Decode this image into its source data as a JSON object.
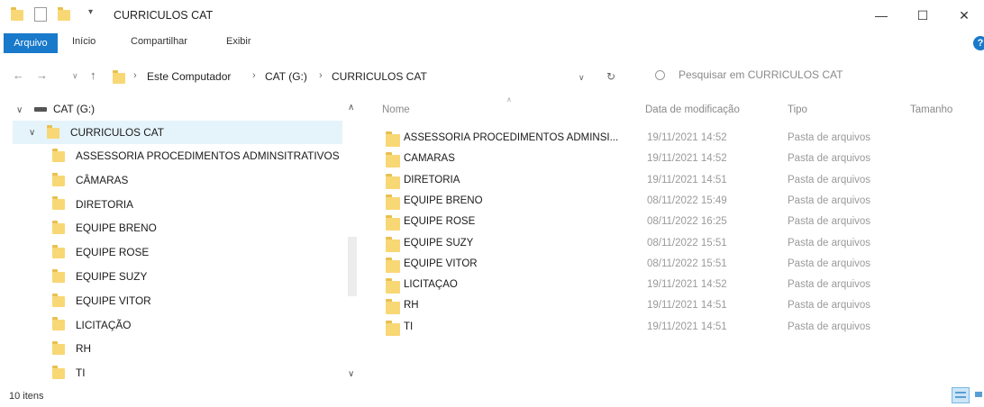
{
  "window": {
    "title": "CURRICULOS CAT",
    "minimize": "—",
    "maximize": "☐",
    "close": "✕"
  },
  "ribbon": {
    "tabs": [
      "Arquivo",
      "Início",
      "Compartilhar",
      "Exibir"
    ],
    "help": "?"
  },
  "address": {
    "back": "←",
    "forward": "→",
    "recent": "∨",
    "up": "↑",
    "crumbs": [
      "Este Computador",
      "CAT (G:)",
      "CURRICULOS CAT"
    ],
    "dropdown": "∨",
    "refresh": "↻",
    "search_placeholder": "Pesquisar em CURRICULOS CAT"
  },
  "navpane": {
    "drive": "CAT (G:)",
    "current": "CURRICULOS CAT",
    "children": [
      "ASSESSORIA PROCEDIMENTOS ADMINSITRATIVOS",
      "CÂMARAS",
      "DIRETORIA",
      "EQUIPE BRENO",
      "EQUIPE ROSE",
      "EQUIPE SUZY",
      "EQUIPE VITOR",
      "LICITAÇÃO",
      "RH",
      "TI"
    ]
  },
  "filelist": {
    "columns": [
      "Nome",
      "Data de modificação",
      "Tipo",
      "Tamanho"
    ],
    "rows": [
      {
        "name": "ASSESSORIA PROCEDIMENTOS ADMINSI...",
        "date": "19/11/2021 14:52",
        "type": "Pasta de arquivos"
      },
      {
        "name": "CÂMARAS",
        "date": "19/11/2021 14:52",
        "type": "Pasta de arquivos"
      },
      {
        "name": "DIRETORIA",
        "date": "19/11/2021 14:51",
        "type": "Pasta de arquivos"
      },
      {
        "name": "EQUIPE BRENO",
        "date": "08/11/2022 15:49",
        "type": "Pasta de arquivos"
      },
      {
        "name": "EQUIPE ROSE",
        "date": "08/11/2022 16:25",
        "type": "Pasta de arquivos"
      },
      {
        "name": "EQUIPE SUZY",
        "date": "08/11/2022 15:51",
        "type": "Pasta de arquivos"
      },
      {
        "name": "EQUIPE VITOR",
        "date": "08/11/2022 15:51",
        "type": "Pasta de arquivos"
      },
      {
        "name": "LICITAÇÃO",
        "date": "19/11/2021 14:52",
        "type": "Pasta de arquivos"
      },
      {
        "name": "RH",
        "date": "19/11/2021 14:51",
        "type": "Pasta de arquivos"
      },
      {
        "name": "TI",
        "date": "19/11/2021 14:51",
        "type": "Pasta de arquivos"
      }
    ]
  },
  "status": {
    "count": "10 itens"
  },
  "colors": {
    "accent": "#1979ca",
    "folder": "#f8d775",
    "selection": "#e5f3fb"
  }
}
